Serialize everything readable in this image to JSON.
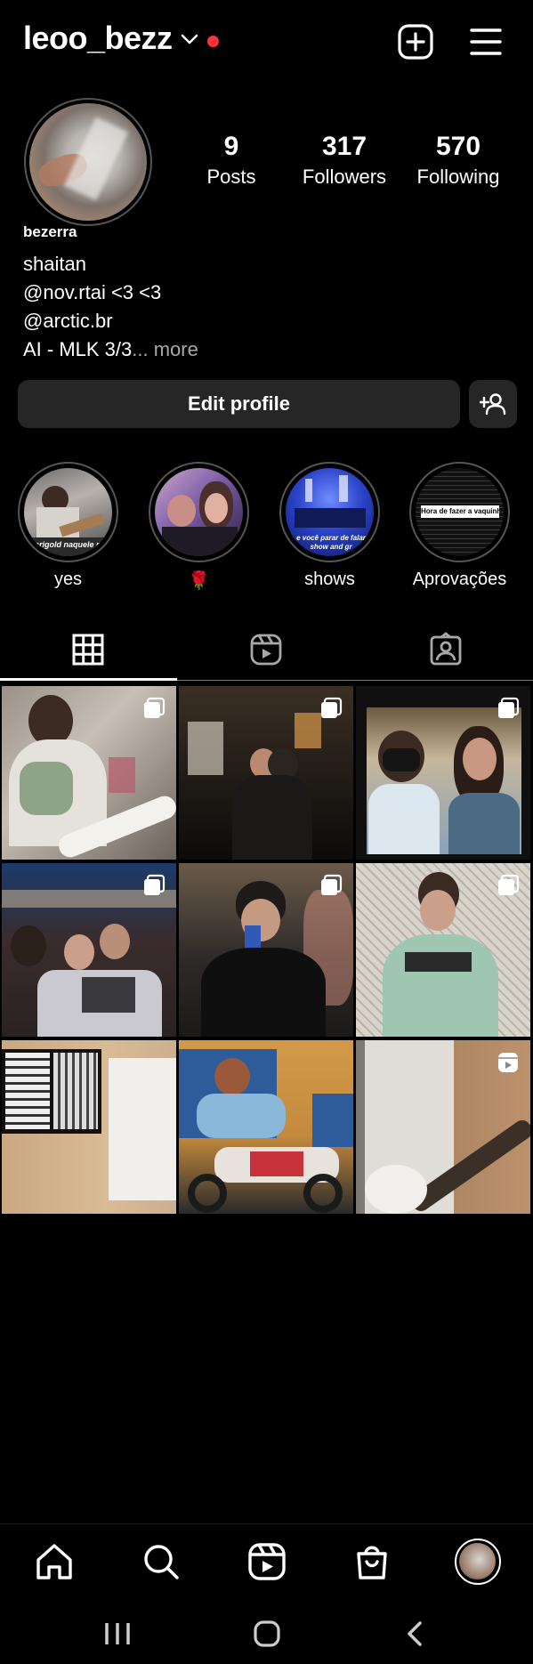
{
  "header": {
    "username": "leoo_bezz"
  },
  "profile": {
    "display_name": "bezerra",
    "stats": [
      {
        "value": "9",
        "label": "Posts"
      },
      {
        "value": "317",
        "label": "Followers"
      },
      {
        "value": "570",
        "label": "Following"
      }
    ],
    "bio_lines": [
      "shaitan",
      "@nov.rtai <3 <3",
      "@arctic.br",
      "AI - MLK 3/3"
    ],
    "bio_more": "... more"
  },
  "actions": {
    "edit_profile": "Edit profile"
  },
  "highlights": [
    {
      "label": "yes",
      "caption": "marigold naquele piqu"
    },
    {
      "label": "🌹",
      "caption": ""
    },
    {
      "label": "shows",
      "caption": "e você parar de falar show and gr"
    },
    {
      "label": "Aprovações",
      "caption": "Hora de fazer a vaquinha"
    }
  ],
  "colors": {
    "background": "#000000",
    "button_bg": "#262626",
    "notification_dot": "#ff3040",
    "muted_text": "#a8a8a8"
  },
  "icons": {
    "header": [
      "chevron-down-icon",
      "new-post-icon",
      "menu-icon"
    ],
    "tabs": [
      "grid-icon",
      "reels-icon",
      "tagged-icon"
    ],
    "bottom_nav": [
      "home-icon",
      "search-icon",
      "reels-icon",
      "shop-icon",
      "profile-avatar"
    ],
    "system_nav": [
      "recents-icon",
      "home-circle-icon",
      "back-icon"
    ]
  }
}
